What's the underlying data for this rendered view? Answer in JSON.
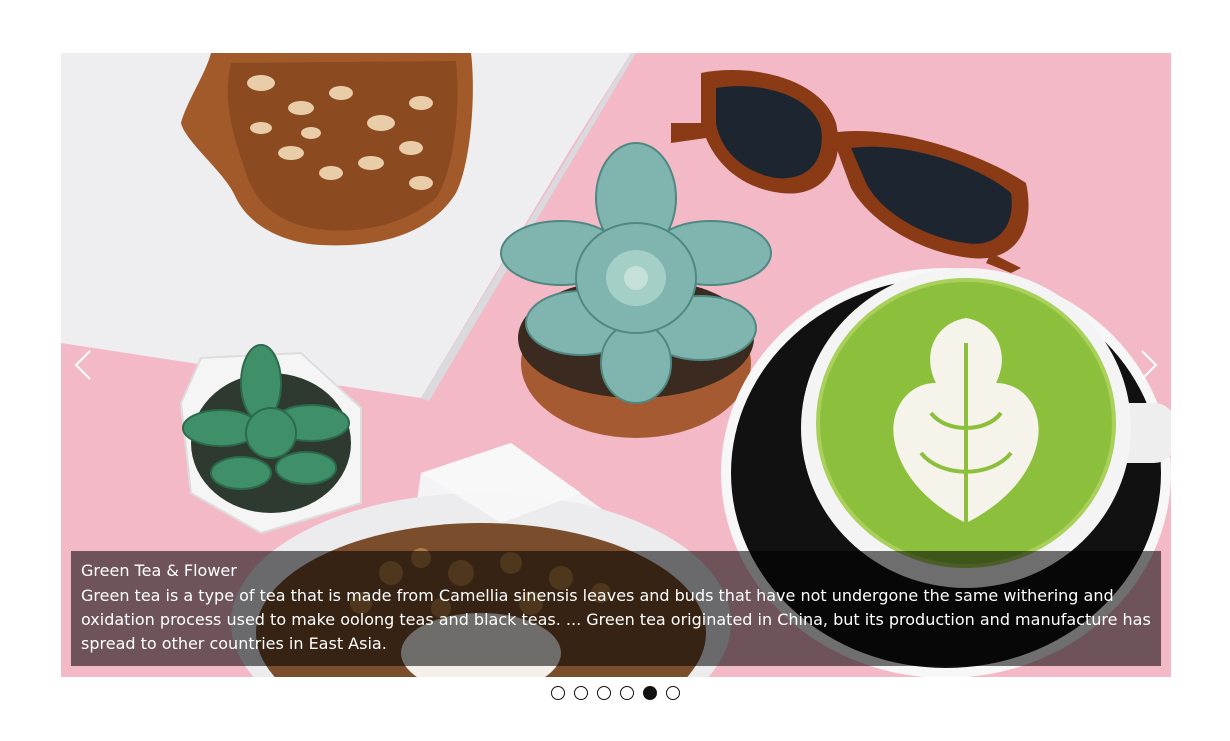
{
  "slider": {
    "slides": [
      {
        "title": "",
        "active": false
      },
      {
        "title": "",
        "active": false
      },
      {
        "title": "",
        "active": false
      },
      {
        "title": "",
        "active": false
      },
      {
        "title": "Green Tea & Flower",
        "active": true
      },
      {
        "title": "",
        "active": false
      }
    ],
    "caption": {
      "title": "Green Tea & Flower",
      "text": "Green tea is a type of tea that is made from Camellia sinensis leaves and buds that have not undergone the same withering and oxidation process used to make oolong teas and black teas. ... Green tea originated in China, but its production and manufacture has spread to other countries in East Asia."
    },
    "prev_icon": "chevron-left-icon",
    "next_icon": "chevron-right-icon",
    "active_index": 4,
    "colors": {
      "caption_bg": "#000000",
      "background_pink": "#f2b8c6",
      "matcha_green": "#8fbf3a",
      "dot_active": "#111111"
    }
  }
}
